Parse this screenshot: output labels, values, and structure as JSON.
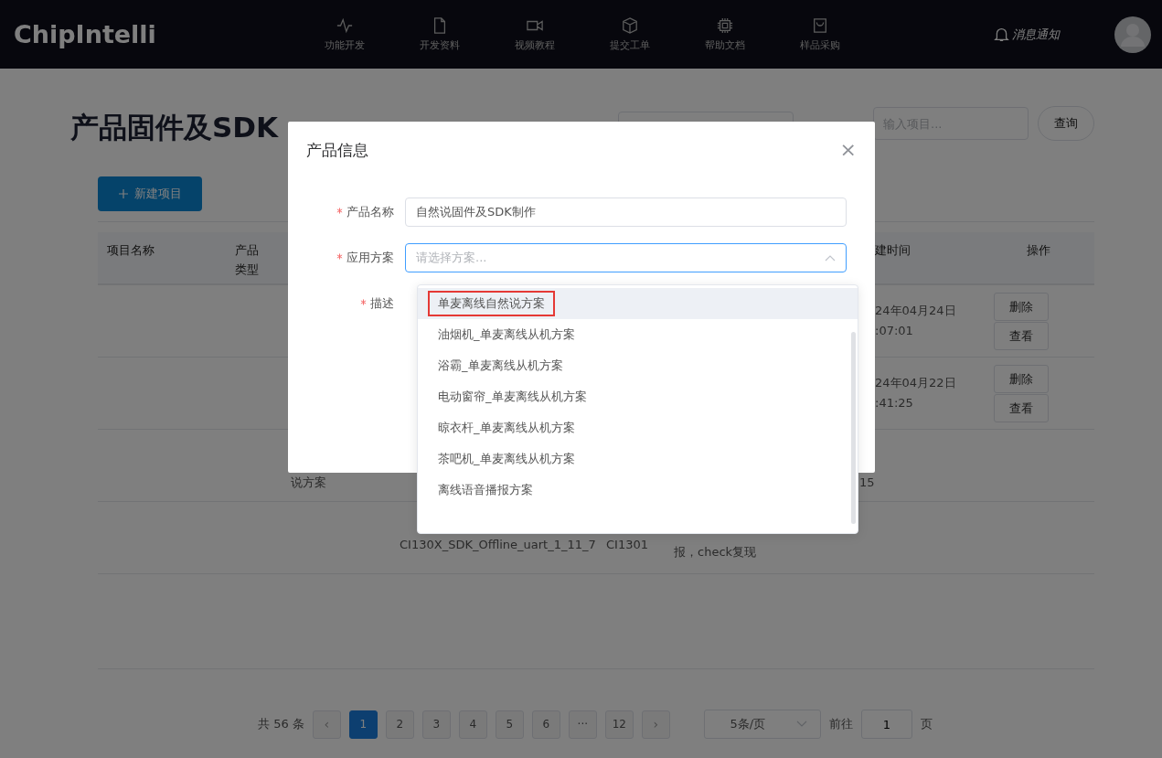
{
  "header": {
    "logo": "ChipIntelli",
    "nav": [
      {
        "label": "功能开发"
      },
      {
        "label": "开发资料"
      },
      {
        "label": "视频教程"
      },
      {
        "label": "提交工单"
      },
      {
        "label": "帮助文档"
      },
      {
        "label": "样品采购"
      }
    ],
    "notification": "消息通知"
  },
  "page": {
    "title": "产品固件及SDK",
    "search": {
      "placeholder": "输入项目..."
    },
    "query_button": "查询",
    "new_button": "新建项目",
    "table": {
      "columns": [
        {
          "label": "项目名称"
        },
        {
          "label": "产品类型"
        },
        {
          "label": "建时间"
        },
        {
          "label": "操作"
        }
      ],
      "rows": [
        {
          "created": [
            "24年04月24日",
            ":07:01"
          ],
          "actions": [
            "删除",
            "查看"
          ]
        },
        {
          "created": [
            "24年04月22日",
            ":41:25"
          ],
          "actions": [
            "删除",
            "查看"
          ]
        },
        {
          "scheme": "说方案",
          "created": [
            "15"
          ]
        },
        {
          "code": "CI130X_SDK_Offline_uart_1_11_7",
          "chip": "CI1301",
          "description": "报，check复现"
        }
      ]
    },
    "pagination": {
      "total": "共 56 条",
      "prev": "‹",
      "pages": [
        {
          "label": "1",
          "selected": true
        },
        {
          "label": "2",
          "selected": false
        },
        {
          "label": "3",
          "selected": false
        },
        {
          "label": "4",
          "selected": false
        },
        {
          "label": "5",
          "selected": false
        },
        {
          "label": "6",
          "selected": false
        },
        {
          "label": "···",
          "selected": false
        },
        {
          "label": "12",
          "selected": false
        }
      ],
      "next": "›",
      "page_size": "5条/页",
      "goto_label": "前往",
      "goto_value": "1",
      "page_unit": "页"
    }
  },
  "modal": {
    "title": "产品信息",
    "close": "×",
    "fields": [
      {
        "kind": "input",
        "label": "产品名称",
        "required": true,
        "value": "自然说固件及SDK制作"
      },
      {
        "kind": "select",
        "label": "应用方案",
        "required": true,
        "placeholder": "请选择方案..."
      },
      {
        "kind": "textarea",
        "label": "描述",
        "required": true
      }
    ],
    "options": [
      {
        "label": "单麦离线自然说方案",
        "highlighted": true,
        "boxed": true
      },
      {
        "label": "油烟机_单麦离线从机方案",
        "highlighted": false,
        "boxed": false
      },
      {
        "label": "浴霸_单麦离线从机方案",
        "highlighted": false,
        "boxed": false
      },
      {
        "label": "电动窗帘_单麦离线从机方案",
        "highlighted": false,
        "boxed": false
      },
      {
        "label": "晾衣杆_单麦离线从机方案",
        "highlighted": false,
        "boxed": false
      },
      {
        "label": "茶吧机_单麦离线从机方案",
        "highlighted": false,
        "boxed": false
      },
      {
        "label": "离线语音播报方案",
        "highlighted": false,
        "boxed": false
      }
    ]
  }
}
